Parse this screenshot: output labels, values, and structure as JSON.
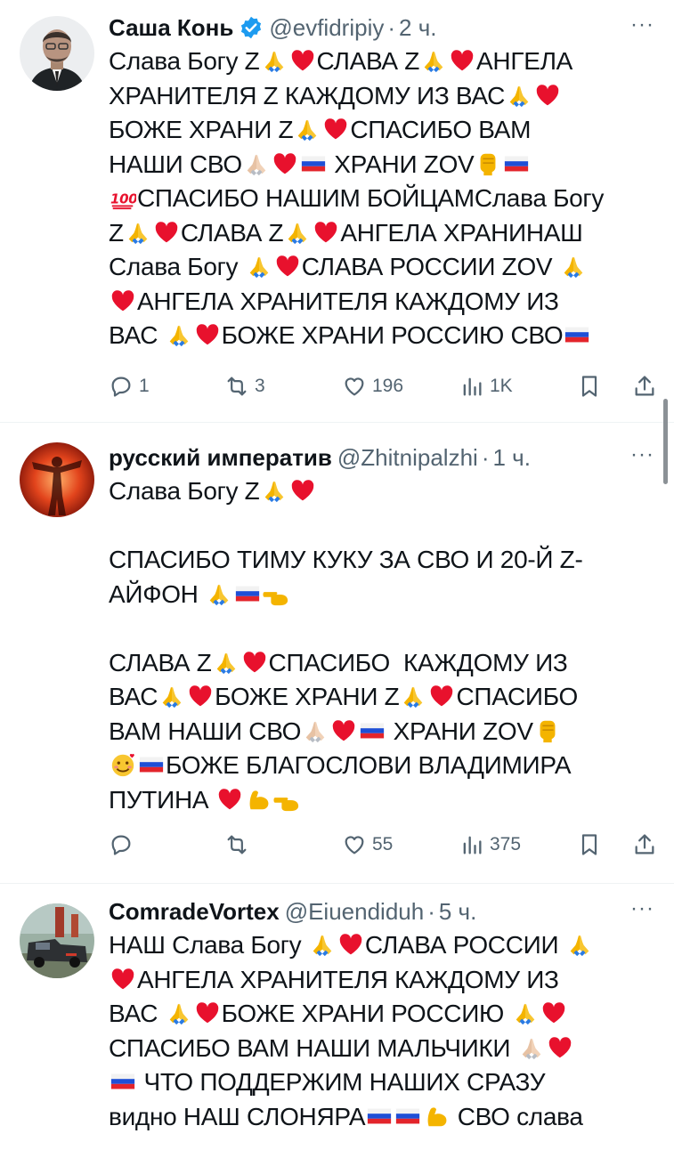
{
  "tweets": [
    {
      "name": "Саша Конь",
      "verified": true,
      "handle": "@evfidripiy",
      "time": "2 ч.",
      "more": "···",
      "lines": [
        [
          "Слава Богу Z",
          "pray",
          "heart",
          "СЛАВА Z",
          "pray",
          "heart",
          "АНГЕЛА"
        ],
        [
          "ХРАНИТЕЛЯ Z КАЖДОМУ ИЗ ВАС",
          "pray",
          "heart"
        ],
        [
          "БОЖЕ ХРАНИ Z",
          "pray",
          "heart",
          "СПАСИБО ВАМ"
        ],
        [
          "НАШИ СВО",
          "pray-light",
          "heart",
          "flag-ru",
          " ХРАНИ ZOV",
          "fist",
          "flag-ru"
        ],
        [
          "hundred",
          "СПАСИБО НАШИМ БОЙЦАМСлава Богу"
        ],
        [
          "Z",
          "pray",
          "heart",
          "СЛАВА Z",
          "pray",
          "heart",
          "АНГЕЛА ХРАНИНАШ"
        ],
        [
          "Слава Богу ",
          "pray",
          "heart",
          "СЛАВА РОССИИ ZOV ",
          "pray"
        ],
        [
          "heart",
          "АНГЕЛА ХРАНИТЕЛЯ КАЖДОМУ ИЗ"
        ],
        [
          "ВАС ",
          "pray",
          "heart",
          "БОЖЕ ХРАНИ РОССИЮ СВО",
          "flag-ru"
        ]
      ],
      "replies": "1",
      "retweets": "3",
      "likes": "196",
      "views": "1K"
    },
    {
      "name": "русский императив",
      "verified": false,
      "handle": "@Zhitnipalzhi",
      "time": "1 ч.",
      "more": "···",
      "lines": [
        [
          "Слава Богу Z",
          "pray",
          "heart"
        ],
        [
          ""
        ],
        [
          "СПАСИБО ТИМУ КУКУ ЗА СВО И 20-Й Z-"
        ],
        [
          "АЙФОН ",
          "pray",
          "flag-ru",
          "point-left"
        ],
        [
          ""
        ],
        [
          "СЛАВА Z",
          "pray",
          "heart",
          "СПАСИБО  КАЖДОМУ ИЗ"
        ],
        [
          "ВАС",
          "pray",
          "heart",
          "БОЖЕ ХРАНИ Z",
          "pray",
          "heart",
          "СПАСИБО"
        ],
        [
          "ВАМ НАШИ СВО",
          "pray-light",
          "heart",
          "flag-ru",
          " ХРАНИ ZOV",
          "fist"
        ],
        [
          "smile-hearts",
          "flag-ru",
          "БОЖЕ БЛАГОСЛОВИ ВЛАДИМИРА"
        ],
        [
          "ПУТИНА ",
          "heart",
          "muscle",
          "point-left"
        ]
      ],
      "replies": "",
      "retweets": "",
      "likes": "55",
      "views": "375"
    },
    {
      "name": "ComradeVortex",
      "verified": false,
      "handle": "@Eiuendiduh",
      "time": "5 ч.",
      "more": "···",
      "lines": [
        [
          "НАШ Слава Богу ",
          "pray",
          "heart",
          "СЛАВА РОССИИ ",
          "pray"
        ],
        [
          "heart",
          "АНГЕЛА ХРАНИТЕЛЯ КАЖДОМУ ИЗ"
        ],
        [
          "ВАС ",
          "pray",
          "heart",
          "БОЖЕ ХРАНИ РОССИЮ ",
          "pray",
          "heart"
        ],
        [
          "СПАСИБО ВАМ НАШИ МАЛЬЧИКИ ",
          "pray-light",
          "heart"
        ],
        [
          "flag-ru",
          " ЧТО ПОДДЕРЖИМ НАШИХ СРАЗУ"
        ],
        [
          "видно НАШ СЛОНЯРА",
          "flag-ru",
          "flag-ru",
          "muscle",
          " СВО слава"
        ]
      ],
      "replies": "",
      "retweets": "",
      "likes": "",
      "views": ""
    }
  ],
  "colors": {
    "text": "#0f1419",
    "secondary": "#536471",
    "verified": "#1d9bf0",
    "divider": "#eff3f4"
  }
}
